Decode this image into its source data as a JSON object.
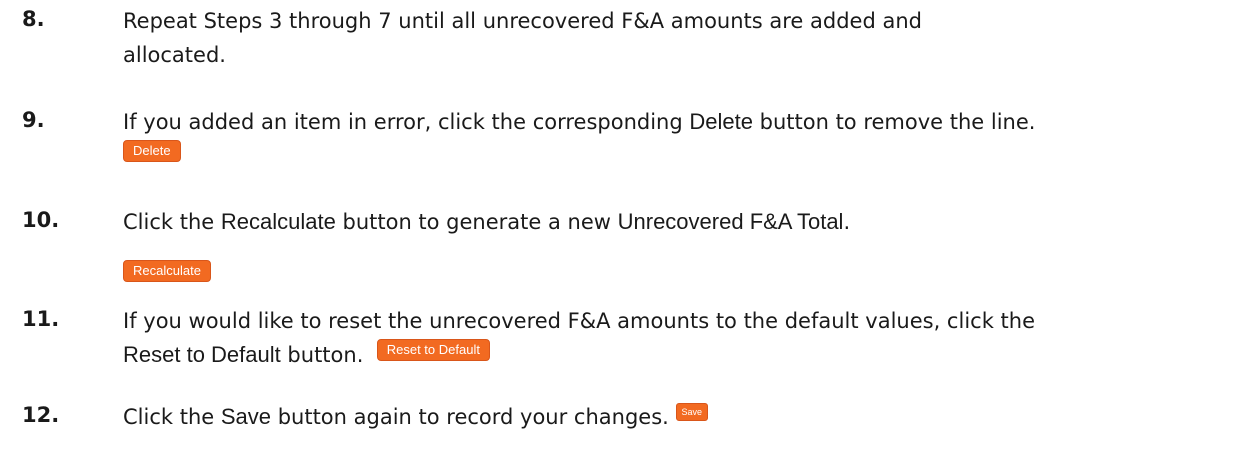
{
  "steps": [
    {
      "number": "8.",
      "line1": "Repeat Steps 3 through 7 until all unrecovered F&A amounts are added and",
      "line2": "allocated."
    },
    {
      "number": "9.",
      "text_before": "If you added an item in error, click the corresponding ",
      "button_word": "Delete",
      "text_after": " button to remove the line.",
      "button_label": "Delete"
    },
    {
      "number": "10.",
      "text_before": "Click the ",
      "button_word": "Recalculate",
      "text_after": " button to generate a new ",
      "text_term": "Unrecovered F&A Total",
      "text_end": ".",
      "button_label": "Recalculate"
    },
    {
      "number": "11.",
      "line1": "If you would like to reset the unrecovered F&A amounts to the default values, click the",
      "button_word": "Reset to Default",
      "text_after": " button.",
      "button_label": "Reset to Default"
    },
    {
      "number": "12.",
      "text_before": "Click the ",
      "button_word": "Save",
      "text_after": " button again to record your changes.",
      "button_label": "Save"
    }
  ],
  "colors": {
    "button_bg": "#f26a21",
    "text": "#1a1a1a"
  }
}
